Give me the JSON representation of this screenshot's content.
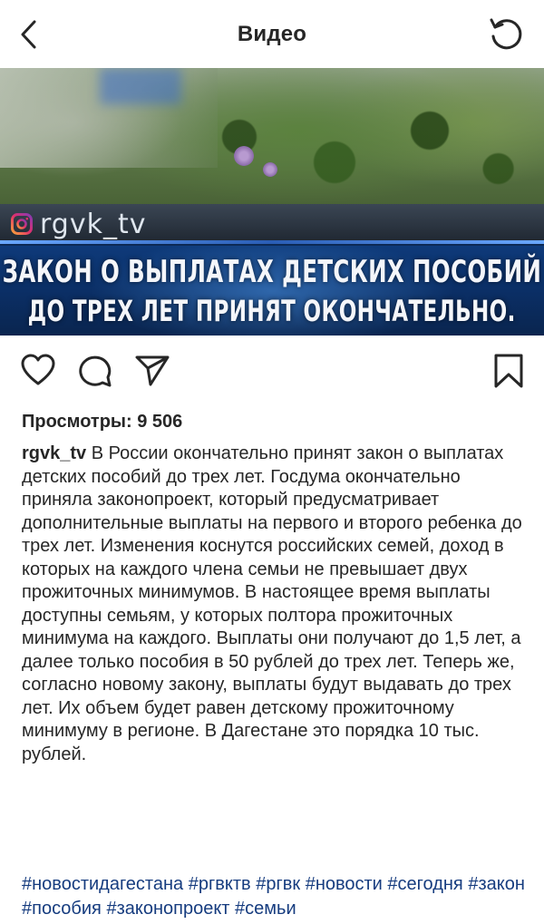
{
  "header": {
    "title": "Видео",
    "back_icon": "chevron-left-icon",
    "refresh_icon": "refresh-icon"
  },
  "video": {
    "handle": "rgvk_tv",
    "headline_line1": "ЗАКОН О ВЫПЛАТАХ ДЕТСКИХ ПОСОБИЙ",
    "headline_line2": "ДО ТРЕХ ЛЕТ ПРИНЯТ ОКОНЧАТЕЛЬНО."
  },
  "actions": {
    "like_icon": "heart-icon",
    "comment_icon": "comment-icon",
    "share_icon": "send-icon",
    "save_icon": "bookmark-icon"
  },
  "stats": {
    "views": "Просмотры: 9 506"
  },
  "post": {
    "username": "rgvk_tv",
    "caption": "В России окончательно принят закон о выплатах детских пособий до трех лет. Госдума окончательно приняла законопроект, который предусматривает дополнительные выплаты на первого и второго ребенка до трех лет. Изменения коснутся российских семей, доход в которых на каждого члена семьи не превышает двух прожиточных минимумов.  В настоящее время выплаты доступны семьям, у которых полтора прожиточных минимума на каждого. Выплаты они получают до 1,5 лет, а далее только пособия в 50 рублей до трех лет.  Теперь же, согласно новому закону, выплаты будут выдавать до трех лет. Их объем будет равен детскому прожиточному минимуму в регионе. В Дагестане это порядка 10 тыс. рублей.",
    "hashtags": [
      "#новостидагестана",
      "#ргвктв",
      "#ргвк",
      "#новости",
      "#сегодня",
      "#закон",
      "#пособия",
      "#законопроект",
      "#семьи"
    ]
  },
  "colors": {
    "text": "#262626",
    "hashtag": "#163c7f",
    "headline_bg": "#0b2f66"
  }
}
